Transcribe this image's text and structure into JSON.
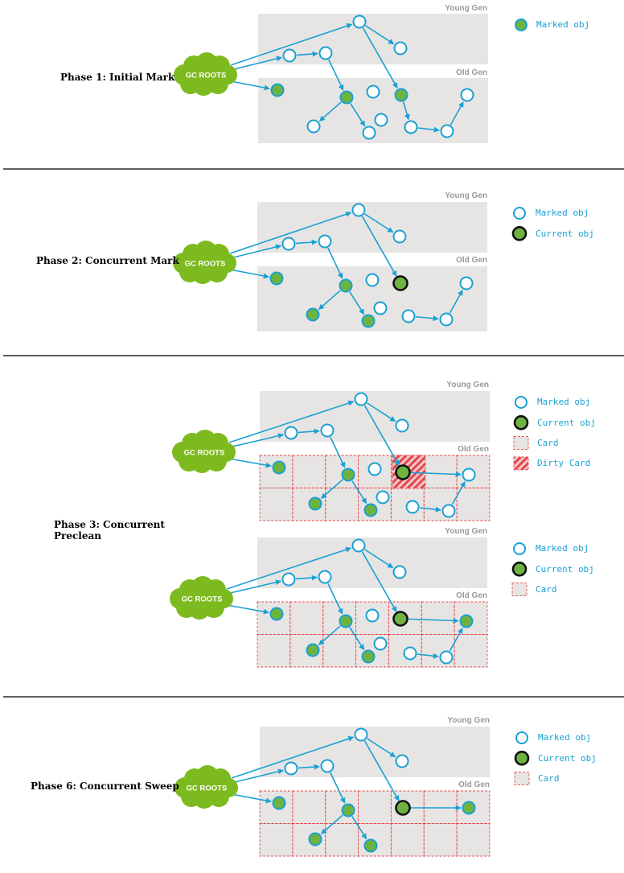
{
  "colors": {
    "region_fill": "#e7e5e3",
    "node_stroke": "#1aa0d4",
    "marked_fill": "#6db33f",
    "current_stroke": "#111111",
    "roots_fill": "#7dba1f",
    "card_stroke": "#e5484d",
    "dirty_fill": "#e5484d",
    "divider": "#000000"
  },
  "labels": {
    "young_gen": "Young Gen",
    "old_gen": "Old Gen",
    "gc_roots": "GC ROOTS",
    "legend_marked": "Marked obj",
    "legend_current": "Current obj",
    "legend_card": "Card",
    "legend_dirty": "Dirty Card"
  },
  "phases": [
    {
      "id": "phase1",
      "label": "Phase 1: Initial Mark"
    },
    {
      "id": "phase2",
      "label": "Phase 2: Concurrent Mark"
    },
    {
      "id": "phase3",
      "label": "Phase 3: Concurrent Preclean"
    },
    {
      "id": "phase6",
      "label": "Phase 6: Concurrent Sweep"
    }
  ]
}
